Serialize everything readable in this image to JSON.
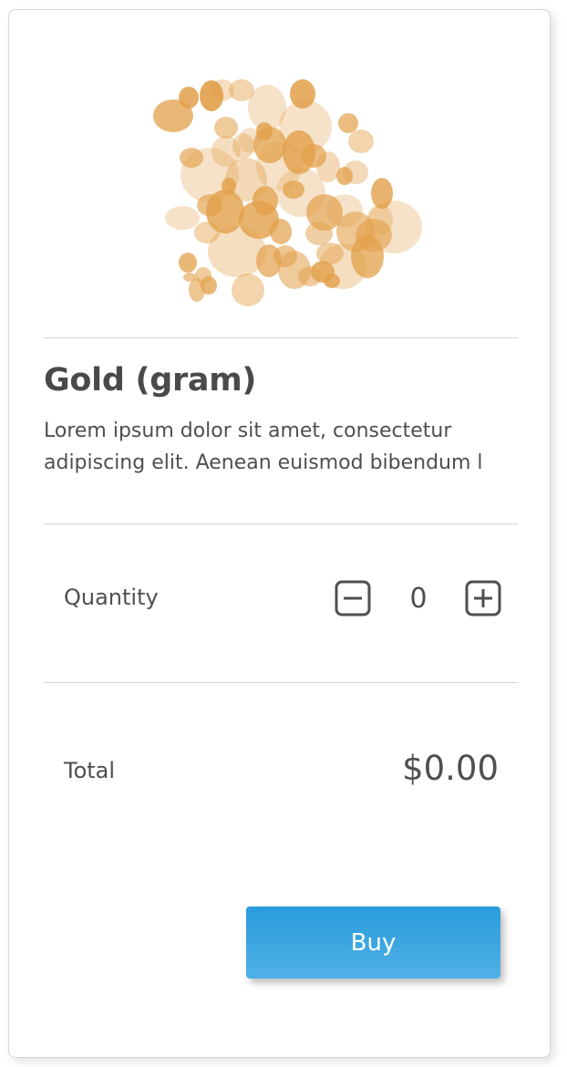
{
  "product": {
    "image_icon": "gold-nuggets-illustration",
    "title": "Gold (gram)",
    "description_lines": [
      "Lorem ipsum dolor sit amet, consectetur",
      "adipiscing elit. Aenean euismod bibendum l"
    ]
  },
  "quantity": {
    "label": "Quantity",
    "value": "0",
    "decrement_icon": "minus-box-icon",
    "increment_icon": "plus-box-icon"
  },
  "total": {
    "label": "Total",
    "value": "$0.00"
  },
  "buy": {
    "label": "Buy"
  },
  "colors": {
    "accent": "#2a9cdb",
    "gold": "#e2a04a",
    "text": "#4f4f4f"
  }
}
